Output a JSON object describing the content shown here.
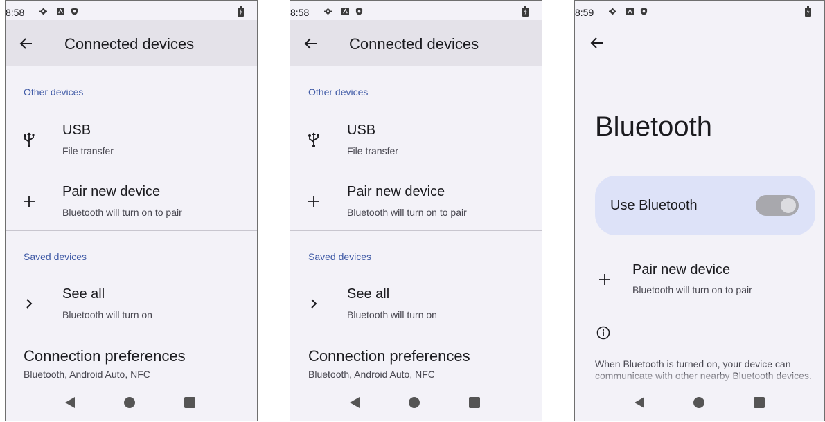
{
  "screens": [
    {
      "status_time": "8:58",
      "title": "Connected devices",
      "section_other": "Other devices",
      "usb_title": "USB",
      "usb_sub": "File transfer",
      "pair_title": "Pair new device",
      "pair_sub": "Bluetooth will turn on to pair",
      "section_saved": "Saved devices",
      "see_all_title": "See all",
      "see_all_sub": "Bluetooth will turn on",
      "pref_title": "Connection preferences",
      "pref_sub": "Bluetooth, Android Auto, NFC"
    },
    {
      "status_time": "8:58",
      "title": "Connected devices",
      "section_other": "Other devices",
      "usb_title": "USB",
      "usb_sub": "File transfer",
      "pair_title": "Pair new device",
      "pair_sub": "Bluetooth will turn on to pair",
      "section_saved": "Saved devices",
      "see_all_title": "See all",
      "see_all_sub": "Bluetooth will turn on",
      "pref_title": "Connection preferences",
      "pref_sub": "Bluetooth, Android Auto, NFC"
    }
  ],
  "bluetooth": {
    "status_time": "8:59",
    "title": "Bluetooth",
    "use_label": "Use Bluetooth",
    "toggle_on": false,
    "pair_title": "Pair new device",
    "pair_sub": "Bluetooth will turn on to pair",
    "info_text": "When Bluetooth is turned on, your device can communicate with other nearby Bluetooth devices."
  },
  "icons": {
    "status": [
      "gear-icon",
      "a-badge-icon",
      "shield-icon",
      "battery-charging-icon"
    ],
    "nav": [
      "back-triangle-icon",
      "home-circle-icon",
      "recents-square-icon"
    ],
    "list": [
      "usb-icon",
      "plus-icon",
      "chevron-right-icon",
      "info-icon",
      "arrow-back-icon"
    ]
  },
  "colors": {
    "background": "#f3f2f8",
    "appbar": "#e4e2e9",
    "section_header": "#3f5aa6",
    "bt_card": "#dde2f8",
    "toggle_off": "#a8a8ad"
  }
}
